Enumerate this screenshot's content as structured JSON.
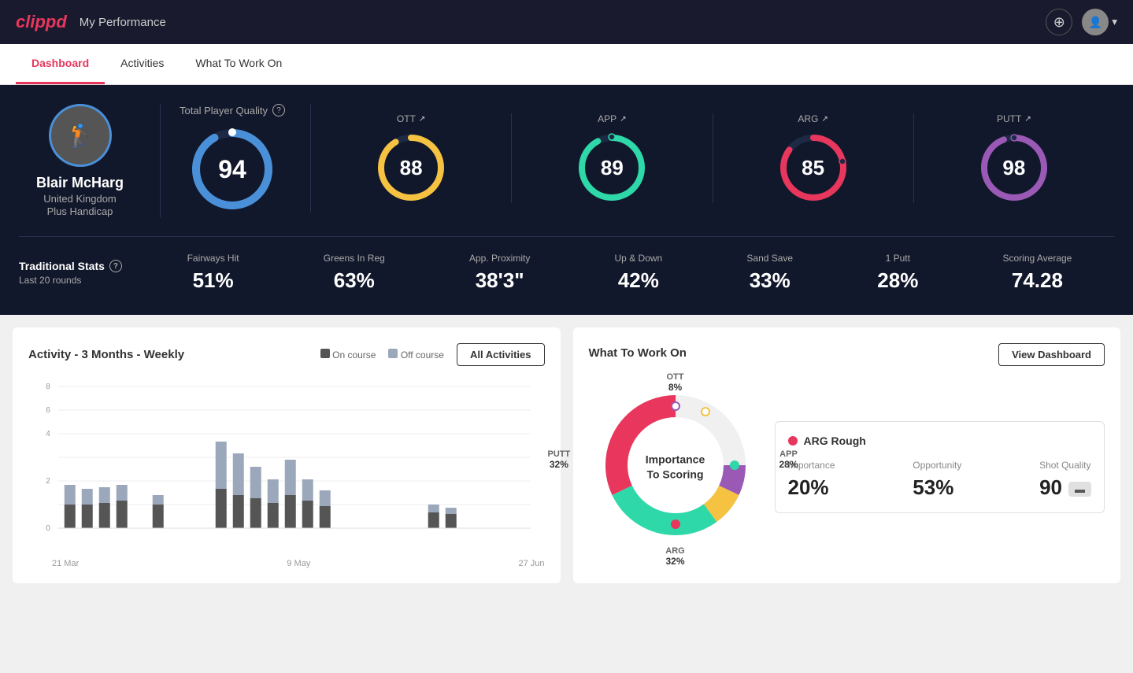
{
  "app": {
    "logo": "clippd",
    "header_title": "My Performance"
  },
  "header": {
    "add_icon": "+",
    "avatar_chevron": "▾"
  },
  "tabs": [
    {
      "id": "dashboard",
      "label": "Dashboard",
      "active": true
    },
    {
      "id": "activities",
      "label": "Activities",
      "active": false
    },
    {
      "id": "what-to-work-on",
      "label": "What To Work On",
      "active": false
    }
  ],
  "player": {
    "name": "Blair McHarg",
    "country": "United Kingdom",
    "handicap": "Plus Handicap"
  },
  "tpq": {
    "label": "Total Player Quality",
    "value": 94,
    "color": "#4a90d9"
  },
  "metrics": [
    {
      "id": "ott",
      "label": "OTT",
      "value": 88,
      "color": "#f5c242"
    },
    {
      "id": "app",
      "label": "APP",
      "value": 89,
      "color": "#2ed8a8"
    },
    {
      "id": "arg",
      "label": "ARG",
      "value": 85,
      "color": "#e8365d"
    },
    {
      "id": "putt",
      "label": "PUTT",
      "value": 98,
      "color": "#9b59b6"
    }
  ],
  "trad_stats": {
    "label": "Traditional Stats",
    "sub": "Last 20 rounds",
    "items": [
      {
        "name": "Fairways Hit",
        "value": "51%"
      },
      {
        "name": "Greens In Reg",
        "value": "63%"
      },
      {
        "name": "App. Proximity",
        "value": "38'3\""
      },
      {
        "name": "Up & Down",
        "value": "42%"
      },
      {
        "name": "Sand Save",
        "value": "33%"
      },
      {
        "name": "1 Putt",
        "value": "28%"
      },
      {
        "name": "Scoring Average",
        "value": "74.28"
      }
    ]
  },
  "activity_chart": {
    "title": "Activity - 3 Months - Weekly",
    "legend": {
      "on_course": "On course",
      "off_course": "Off course"
    },
    "all_activities_btn": "All Activities",
    "x_labels": [
      "21 Mar",
      "9 May",
      "27 Jun"
    ],
    "colors": {
      "on_course": "#555",
      "off_course": "#9ba8bb"
    }
  },
  "wtwo": {
    "title": "What To Work On",
    "view_dashboard_btn": "View Dashboard",
    "center_text": "Importance\nTo Scoring",
    "segments": [
      {
        "id": "ott",
        "label": "OTT",
        "percent": "8%",
        "color": "#f5c242"
      },
      {
        "id": "app",
        "label": "APP",
        "percent": "28%",
        "color": "#2ed8a8"
      },
      {
        "id": "arg",
        "label": "ARG",
        "percent": "32%",
        "color": "#e8365d"
      },
      {
        "id": "putt",
        "label": "PUTT",
        "percent": "32%",
        "color": "#9b59b6"
      }
    ],
    "arg_card": {
      "title": "ARG Rough",
      "metrics": [
        {
          "label": "Importance",
          "value": "20%"
        },
        {
          "label": "Opportunity",
          "value": "53%"
        },
        {
          "label": "Shot Quality",
          "value": "90"
        }
      ]
    }
  }
}
